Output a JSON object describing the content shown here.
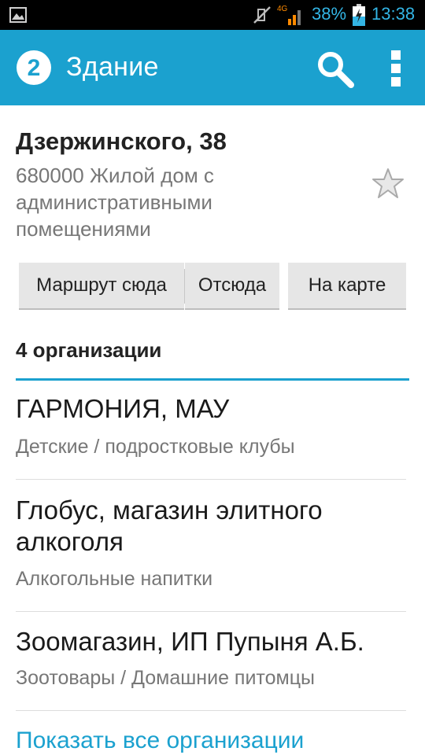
{
  "status_bar": {
    "battery_percent": "38%",
    "time": "13:38",
    "network": "4G",
    "accent_color": "#33b5e5"
  },
  "action_bar": {
    "title": "Здание",
    "logo_text": "2",
    "color": "#1ba1cf",
    "icons": [
      "app-logo-icon",
      "search-icon",
      "overflow-menu-icon"
    ]
  },
  "building": {
    "address": "Дзержинского, 38",
    "description": "680000 Жилой дом с административными помещениями",
    "favorite_icon": "star-outline-icon"
  },
  "buttons": {
    "route_here": "Маршрут сюда",
    "from_here": "Отсюда",
    "on_map": "На карте"
  },
  "organizations": {
    "heading": "4 организации",
    "items": [
      {
        "name": "ГАРМОНИЯ, МАУ",
        "category": "Детские / подростковые клубы"
      },
      {
        "name": "Глобус, магазин элитного алкоголя",
        "category": "Алкогольные напитки"
      },
      {
        "name": "Зоомагазин, ИП Пупыня А.Б.",
        "category": "Зоотовары / Домашние питомцы"
      }
    ],
    "show_all": "Показать все организации"
  }
}
